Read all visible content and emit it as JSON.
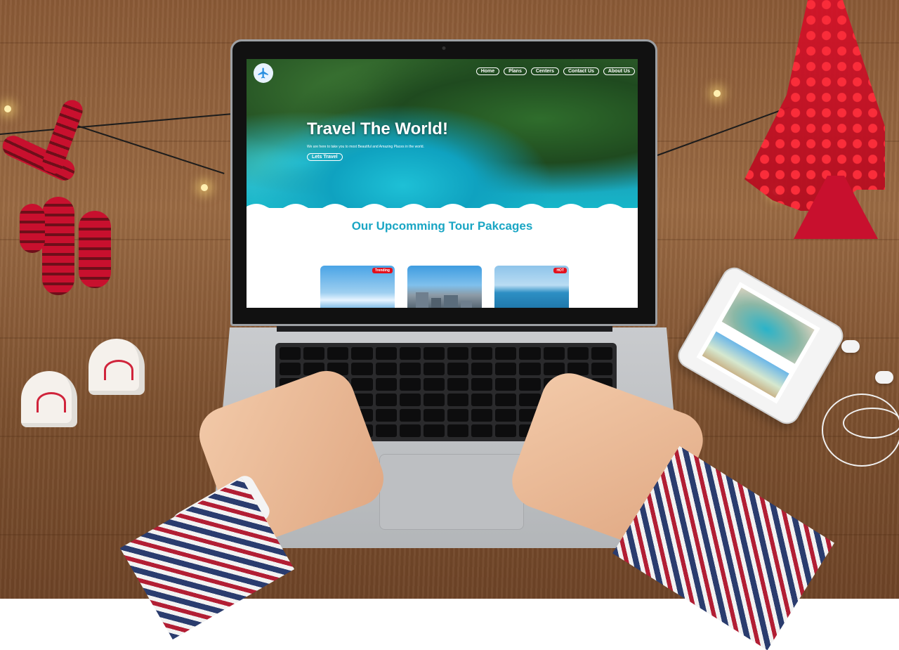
{
  "site": {
    "nav": [
      "Home",
      "Plans",
      "Centers",
      "Contact Us",
      "About Us"
    ],
    "hero": {
      "title": "Travel The World!",
      "subtitle": "We are here to take you to most Beautiful and Amazing Places in the world.",
      "cta": "Lets Travel"
    },
    "section_title": "Our Upcomming Tour Pakcages",
    "cards": [
      {
        "badge": "Trending"
      },
      {
        "badge": ""
      },
      {
        "badge": "HOT"
      }
    ]
  },
  "icons": {
    "logo": "airplane-icon"
  },
  "colors": {
    "accent": "#1aa6c4",
    "badge": "#e3101d"
  }
}
